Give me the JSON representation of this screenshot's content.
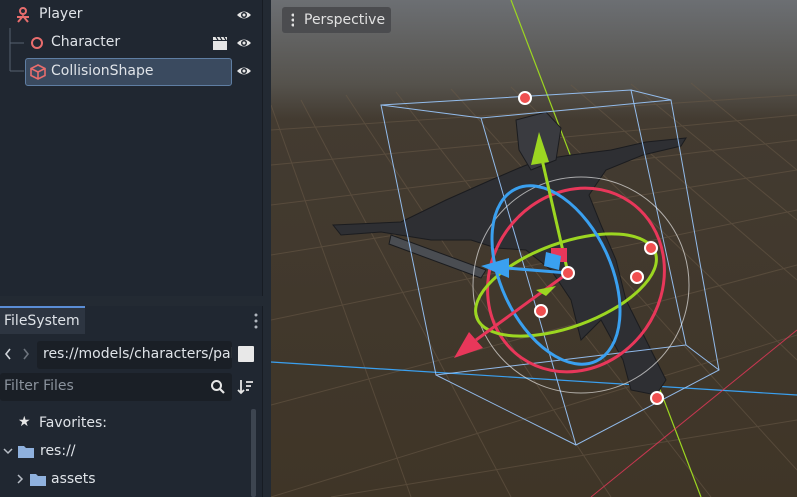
{
  "scene_tree": {
    "nodes": [
      {
        "label": "Player",
        "icon": "player-node-icon",
        "color": "#e86d6d"
      },
      {
        "label": "Character",
        "icon": "circle-node-icon",
        "color": "#e86d6d"
      },
      {
        "label": "CollisionShape",
        "icon": "cube-node-icon",
        "color": "#e86d6d",
        "selected": true
      }
    ]
  },
  "filesystem": {
    "tab_label": "FileSystem",
    "path_value": "res://models/characters/pal",
    "filter_placeholder": "Filter Files",
    "tree": [
      {
        "label": "Favorites:",
        "icon": "star-icon"
      },
      {
        "label": "res://",
        "icon": "folder-icon"
      },
      {
        "label": "assets",
        "icon": "folder-icon"
      }
    ]
  },
  "viewport": {
    "view_mode_label": "Perspective"
  },
  "colors": {
    "accent": "#5a8dd6",
    "x_axis": "#e8375a",
    "y_axis": "#9cd621",
    "z_axis": "#3aa0f0"
  }
}
